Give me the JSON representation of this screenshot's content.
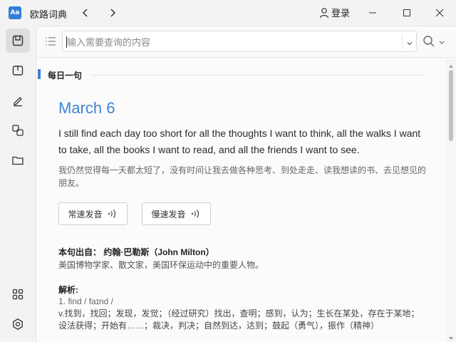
{
  "app": {
    "icon_text": "Aa",
    "title": "欧路词典",
    "login_label": "登录"
  },
  "search": {
    "placeholder": "输入需要查询的内容",
    "value": ""
  },
  "daily": {
    "section_title": "每日一句",
    "date": "March 6",
    "quote_en": "I still find each day too short for all the thoughts I want to think, all the walks I want to take, all the books I want to read, and all the friends I want to see.",
    "quote_zh": "我仍然觉得每一天都太短了，没有时间让我去做各种思考、到处走走、读我想读的书、去见想见的朋友。",
    "speak_normal_label": "常速发音",
    "speak_slow_label": "慢速发音",
    "source_label": "本句出自：  约翰·巴勒斯（John Milton）",
    "source_desc": "美国博物学家、散文家，美国环保运动中的重要人物。",
    "analysis_label": "解析:",
    "phonetic": "1. find / faɪnd /",
    "definition": "v.找到，找回；发现，发觉；（经过研究）找出，查明；感到，认为；生长在某处，存在于某地；设法获得；开始有……；裁决，判决；自然到达，达到；鼓起（勇气），振作（精神）"
  },
  "icons": {
    "back": "chevron-left-icon",
    "forward": "chevron-right-icon",
    "user": "user-icon",
    "minimize": "minimize-icon",
    "maximize": "maximize-icon",
    "close": "close-icon",
    "sidebar": [
      "dictionary-icon",
      "book-icon",
      "edit-icon",
      "translate-icon",
      "folder-icon",
      "apps-icon",
      "settings-icon"
    ],
    "list": "list-icon",
    "search": "search-icon",
    "sound": "sound-wave-icon"
  },
  "colors": {
    "accent": "#3f85d4",
    "section_mark": "#3c82d8",
    "app_icon": "#2f7fd8"
  }
}
